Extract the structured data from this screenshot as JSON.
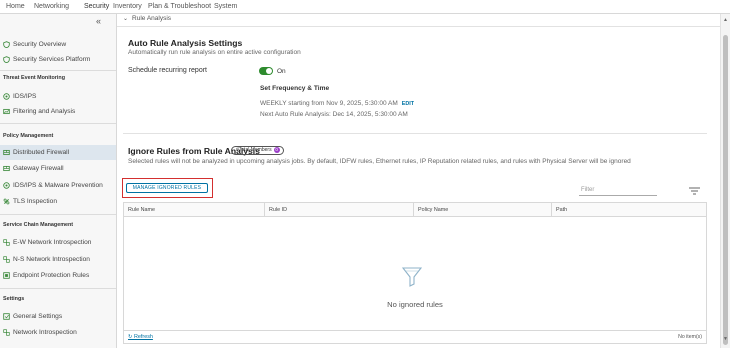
{
  "topnav": {
    "tabs": [
      {
        "label": "Home"
      },
      {
        "label": "Networking"
      },
      {
        "label": "Security"
      },
      {
        "label": "Inventory"
      },
      {
        "label": "Plan & Troubleshoot"
      },
      {
        "label": "System"
      }
    ],
    "active_tab": "Security"
  },
  "sidebar": {
    "collapse_glyph": "«",
    "items": [
      {
        "label": "Security Overview",
        "icon": "shield-icon"
      },
      {
        "label": "Security Services Platform",
        "icon": "shield-icon"
      },
      {
        "label": "IDS/IPS",
        "icon": "radar-icon"
      },
      {
        "label": "Filtering and Analysis",
        "icon": "filter-chart-icon"
      },
      {
        "label": "Distributed Firewall",
        "icon": "firewall-icon"
      },
      {
        "label": "Gateway Firewall",
        "icon": "firewall-icon"
      },
      {
        "label": "IDS/IPS & Malware Prevention",
        "icon": "radar-icon"
      },
      {
        "label": "TLS Inspection",
        "icon": "lock-shield-icon"
      },
      {
        "label": "E-W Network Introspection",
        "icon": "network-icon"
      },
      {
        "label": "N-S Network Introspection",
        "icon": "network-icon"
      },
      {
        "label": "Endpoint Protection Rules",
        "icon": "endpoint-icon"
      },
      {
        "label": "General Settings",
        "icon": "settings-icon"
      },
      {
        "label": "Network Introspection",
        "icon": "network-icon"
      }
    ],
    "groups": {
      "threat": "Threat Event Monitoring",
      "policy": "Policy Management",
      "chain": "Service Chain Management",
      "settings": "Settings"
    },
    "active_item": "Distributed Firewall"
  },
  "breadcrumb": {
    "chevron": "⌄",
    "label": "Rule Analysis"
  },
  "auto": {
    "title": "Auto Rule Analysis Settings",
    "subtitle": "Automatically run rule analysis on entire active configuration",
    "schedule_label": "Schedule recurring report",
    "toggle_label": "On",
    "toggle_on": true,
    "freq_title": "Set Frequency & Time",
    "weekly": "WEEKLY starting from Nov 9, 2025, 5:30:00 AM",
    "edit": "EDIT",
    "next": "Next Auto Rule Analysis: Dec 14, 2025, 5:30:00 AM"
  },
  "ignore": {
    "title": "Ignore Rules from Rule Analysis",
    "badge_label": "#Total Members",
    "badge_count": "0",
    "subtitle": "Selected rules will not be analyzed in upcoming analysis jobs. By default, IDFW rules, Ethernet rules, IP Reputation related rules, and rules with Physical Server will be ignored",
    "manage_button": "MANAGE IGNORED RULES",
    "filter_placeholder": "Filter"
  },
  "grid": {
    "columns": [
      "Rule Name",
      "Rule ID",
      "Policy Name",
      "Path"
    ],
    "empty_text": "No ignored rules",
    "refresh": "Refresh",
    "items": "No item(s)"
  },
  "colors": {
    "accent": "#0072a3",
    "toggle": "#2e8b2e",
    "highlight": "#d32f2f",
    "badge": "#9b3ec8"
  }
}
